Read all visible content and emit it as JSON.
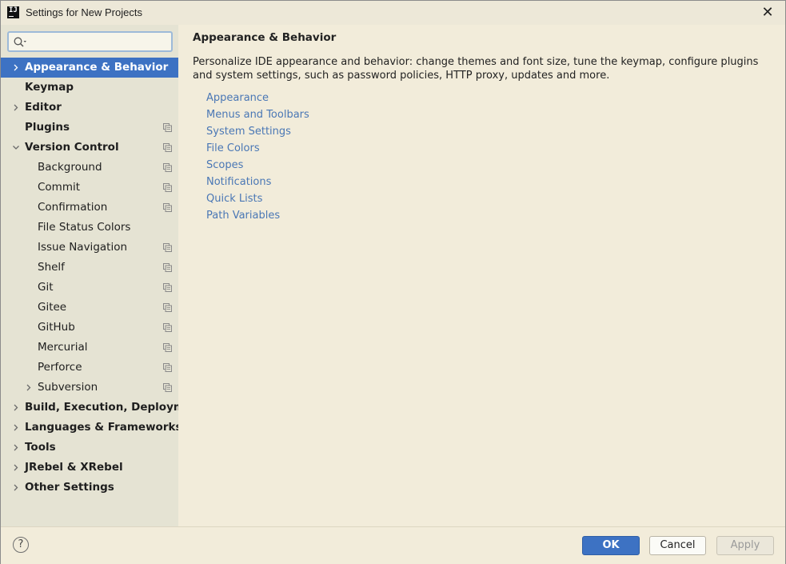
{
  "window": {
    "title": "Settings for New Projects",
    "icon": "intellij-icon",
    "close_icon": "close-icon"
  },
  "search": {
    "value": "",
    "placeholder": ""
  },
  "sidebar": {
    "items": [
      {
        "label": "Appearance & Behavior",
        "level": 0,
        "bold": true,
        "expander": "collapsed",
        "selected": true,
        "copy_icon": false
      },
      {
        "label": "Keymap",
        "level": 0,
        "bold": true,
        "expander": "none",
        "copy_icon": false
      },
      {
        "label": "Editor",
        "level": 0,
        "bold": true,
        "expander": "collapsed",
        "copy_icon": false
      },
      {
        "label": "Plugins",
        "level": 0,
        "bold": true,
        "expander": "none",
        "copy_icon": true
      },
      {
        "label": "Version Control",
        "level": 0,
        "bold": true,
        "expander": "expanded",
        "copy_icon": true
      },
      {
        "label": "Background",
        "level": 1,
        "bold": false,
        "expander": "none",
        "copy_icon": true
      },
      {
        "label": "Commit",
        "level": 1,
        "bold": false,
        "expander": "none",
        "copy_icon": true
      },
      {
        "label": "Confirmation",
        "level": 1,
        "bold": false,
        "expander": "none",
        "copy_icon": true
      },
      {
        "label": "File Status Colors",
        "level": 1,
        "bold": false,
        "expander": "none",
        "copy_icon": false
      },
      {
        "label": "Issue Navigation",
        "level": 1,
        "bold": false,
        "expander": "none",
        "copy_icon": true
      },
      {
        "label": "Shelf",
        "level": 1,
        "bold": false,
        "expander": "none",
        "copy_icon": true
      },
      {
        "label": "Git",
        "level": 1,
        "bold": false,
        "expander": "none",
        "copy_icon": true
      },
      {
        "label": "Gitee",
        "level": 1,
        "bold": false,
        "expander": "none",
        "copy_icon": true
      },
      {
        "label": "GitHub",
        "level": 1,
        "bold": false,
        "expander": "none",
        "copy_icon": true
      },
      {
        "label": "Mercurial",
        "level": 1,
        "bold": false,
        "expander": "none",
        "copy_icon": true
      },
      {
        "label": "Perforce",
        "level": 1,
        "bold": false,
        "expander": "none",
        "copy_icon": true
      },
      {
        "label": "Subversion",
        "level": 1,
        "bold": false,
        "expander": "collapsed",
        "copy_icon": true
      },
      {
        "label": "Build, Execution, Deployment",
        "level": 0,
        "bold": true,
        "expander": "collapsed",
        "copy_icon": false
      },
      {
        "label": "Languages & Frameworks",
        "level": 0,
        "bold": true,
        "expander": "collapsed",
        "copy_icon": false
      },
      {
        "label": "Tools",
        "level": 0,
        "bold": true,
        "expander": "collapsed",
        "copy_icon": false
      },
      {
        "label": "JRebel & XRebel",
        "level": 0,
        "bold": true,
        "expander": "collapsed",
        "copy_icon": false
      },
      {
        "label": "Other Settings",
        "level": 0,
        "bold": true,
        "expander": "collapsed",
        "copy_icon": false
      }
    ]
  },
  "main": {
    "title": "Appearance & Behavior",
    "description": "Personalize IDE appearance and behavior: change themes and font size, tune the keymap, configure plugins and system settings, such as password policies, HTTP proxy, updates and more.",
    "links": [
      "Appearance",
      "Menus and Toolbars",
      "System Settings",
      "File Colors",
      "Scopes",
      "Notifications",
      "Quick Lists",
      "Path Variables"
    ]
  },
  "footer": {
    "help_label": "?",
    "ok_label": "OK",
    "cancel_label": "Cancel",
    "apply_label": "Apply"
  },
  "colors": {
    "selection": "#3d72c3",
    "link": "#4a77b5",
    "sidebar_bg": "#e5e3d3",
    "content_bg": "#f2ecda"
  }
}
